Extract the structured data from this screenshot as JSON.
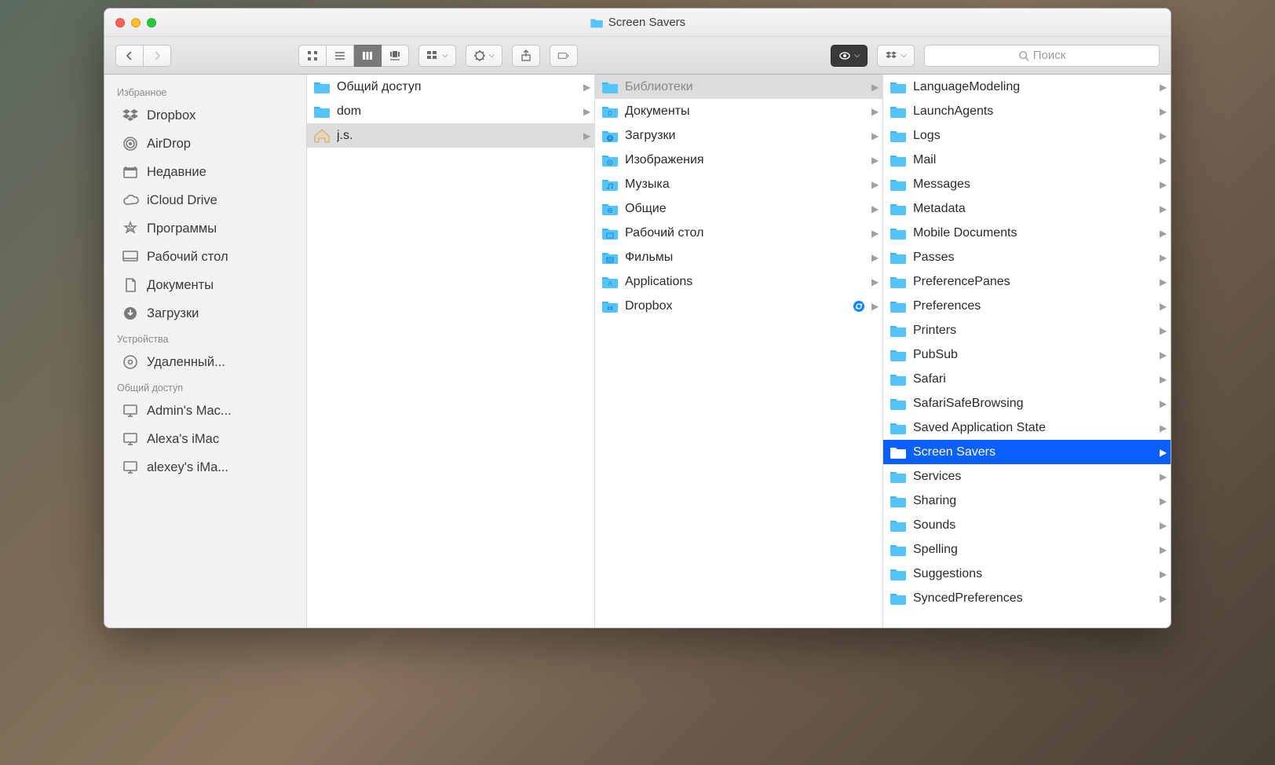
{
  "window": {
    "title": "Screen Savers"
  },
  "search": {
    "placeholder": "Поиск"
  },
  "sidebar": {
    "sections": [
      {
        "header": "Избранное",
        "items": [
          {
            "icon": "dropbox",
            "label": "Dropbox"
          },
          {
            "icon": "airdrop",
            "label": "AirDrop"
          },
          {
            "icon": "recents",
            "label": "Недавние"
          },
          {
            "icon": "icloud",
            "label": "iCloud Drive"
          },
          {
            "icon": "apps",
            "label": "Программы"
          },
          {
            "icon": "desktop",
            "label": "Рабочий стол"
          },
          {
            "icon": "documents",
            "label": "Документы"
          },
          {
            "icon": "downloads",
            "label": "Загрузки"
          }
        ]
      },
      {
        "header": "Устройства",
        "items": [
          {
            "icon": "disc",
            "label": "Удаленный..."
          }
        ]
      },
      {
        "header": "Общий доступ",
        "items": [
          {
            "icon": "computer",
            "label": "Admin's Mac..."
          },
          {
            "icon": "computer",
            "label": "Alexa's iMac"
          },
          {
            "icon": "computer",
            "label": "alexey's iMa..."
          }
        ]
      }
    ]
  },
  "columns": [
    {
      "items": [
        {
          "icon": "folder",
          "label": "Общий доступ",
          "arrow": true,
          "state": "normal"
        },
        {
          "icon": "folder",
          "label": "dom",
          "arrow": true,
          "state": "normal"
        },
        {
          "icon": "home",
          "label": "j.s.",
          "arrow": true,
          "state": "sel-path"
        }
      ]
    },
    {
      "items": [
        {
          "icon": "folder",
          "label": "Библиотеки",
          "arrow": true,
          "state": "sel-path-dim"
        },
        {
          "icon": "folder-docs",
          "label": "Документы",
          "arrow": true,
          "state": "normal"
        },
        {
          "icon": "folder-dl",
          "label": "Загрузки",
          "arrow": true,
          "state": "normal"
        },
        {
          "icon": "folder-img",
          "label": "Изображения",
          "arrow": true,
          "state": "normal"
        },
        {
          "icon": "folder-music",
          "label": "Музыка",
          "arrow": true,
          "state": "normal"
        },
        {
          "icon": "folder-public",
          "label": "Общие",
          "arrow": true,
          "state": "normal"
        },
        {
          "icon": "folder-desk",
          "label": "Рабочий стол",
          "arrow": true,
          "state": "normal"
        },
        {
          "icon": "folder-movies",
          "label": "Фильмы",
          "arrow": true,
          "state": "normal"
        },
        {
          "icon": "folder-apps",
          "label": "Applications",
          "arrow": true,
          "state": "normal"
        },
        {
          "icon": "folder-dropbox",
          "label": "Dropbox",
          "arrow": true,
          "state": "normal",
          "sync": true
        }
      ]
    },
    {
      "items": [
        {
          "icon": "folder",
          "label": "LanguageModeling",
          "arrow": true,
          "state": "normal"
        },
        {
          "icon": "folder",
          "label": "LaunchAgents",
          "arrow": true,
          "state": "normal"
        },
        {
          "icon": "folder",
          "label": "Logs",
          "arrow": true,
          "state": "normal"
        },
        {
          "icon": "folder",
          "label": "Mail",
          "arrow": true,
          "state": "normal"
        },
        {
          "icon": "folder",
          "label": "Messages",
          "arrow": true,
          "state": "normal"
        },
        {
          "icon": "folder",
          "label": "Metadata",
          "arrow": true,
          "state": "normal"
        },
        {
          "icon": "folder",
          "label": "Mobile Documents",
          "arrow": true,
          "state": "normal"
        },
        {
          "icon": "folder",
          "label": "Passes",
          "arrow": true,
          "state": "normal"
        },
        {
          "icon": "folder",
          "label": "PreferencePanes",
          "arrow": true,
          "state": "normal"
        },
        {
          "icon": "folder",
          "label": "Preferences",
          "arrow": true,
          "state": "normal"
        },
        {
          "icon": "folder",
          "label": "Printers",
          "arrow": true,
          "state": "normal"
        },
        {
          "icon": "folder",
          "label": "PubSub",
          "arrow": true,
          "state": "normal"
        },
        {
          "icon": "folder",
          "label": "Safari",
          "arrow": true,
          "state": "normal"
        },
        {
          "icon": "folder",
          "label": "SafariSafeBrowsing",
          "arrow": true,
          "state": "normal"
        },
        {
          "icon": "folder",
          "label": "Saved Application State",
          "arrow": true,
          "state": "normal"
        },
        {
          "icon": "folder",
          "label": "Screen Savers",
          "arrow": true,
          "state": "sel-active"
        },
        {
          "icon": "folder",
          "label": "Services",
          "arrow": true,
          "state": "normal"
        },
        {
          "icon": "folder",
          "label": "Sharing",
          "arrow": true,
          "state": "normal"
        },
        {
          "icon": "folder",
          "label": "Sounds",
          "arrow": true,
          "state": "normal"
        },
        {
          "icon": "folder",
          "label": "Spelling",
          "arrow": true,
          "state": "normal"
        },
        {
          "icon": "folder",
          "label": "Suggestions",
          "arrow": true,
          "state": "normal"
        },
        {
          "icon": "folder",
          "label": "SyncedPreferences",
          "arrow": true,
          "state": "normal"
        }
      ]
    }
  ]
}
